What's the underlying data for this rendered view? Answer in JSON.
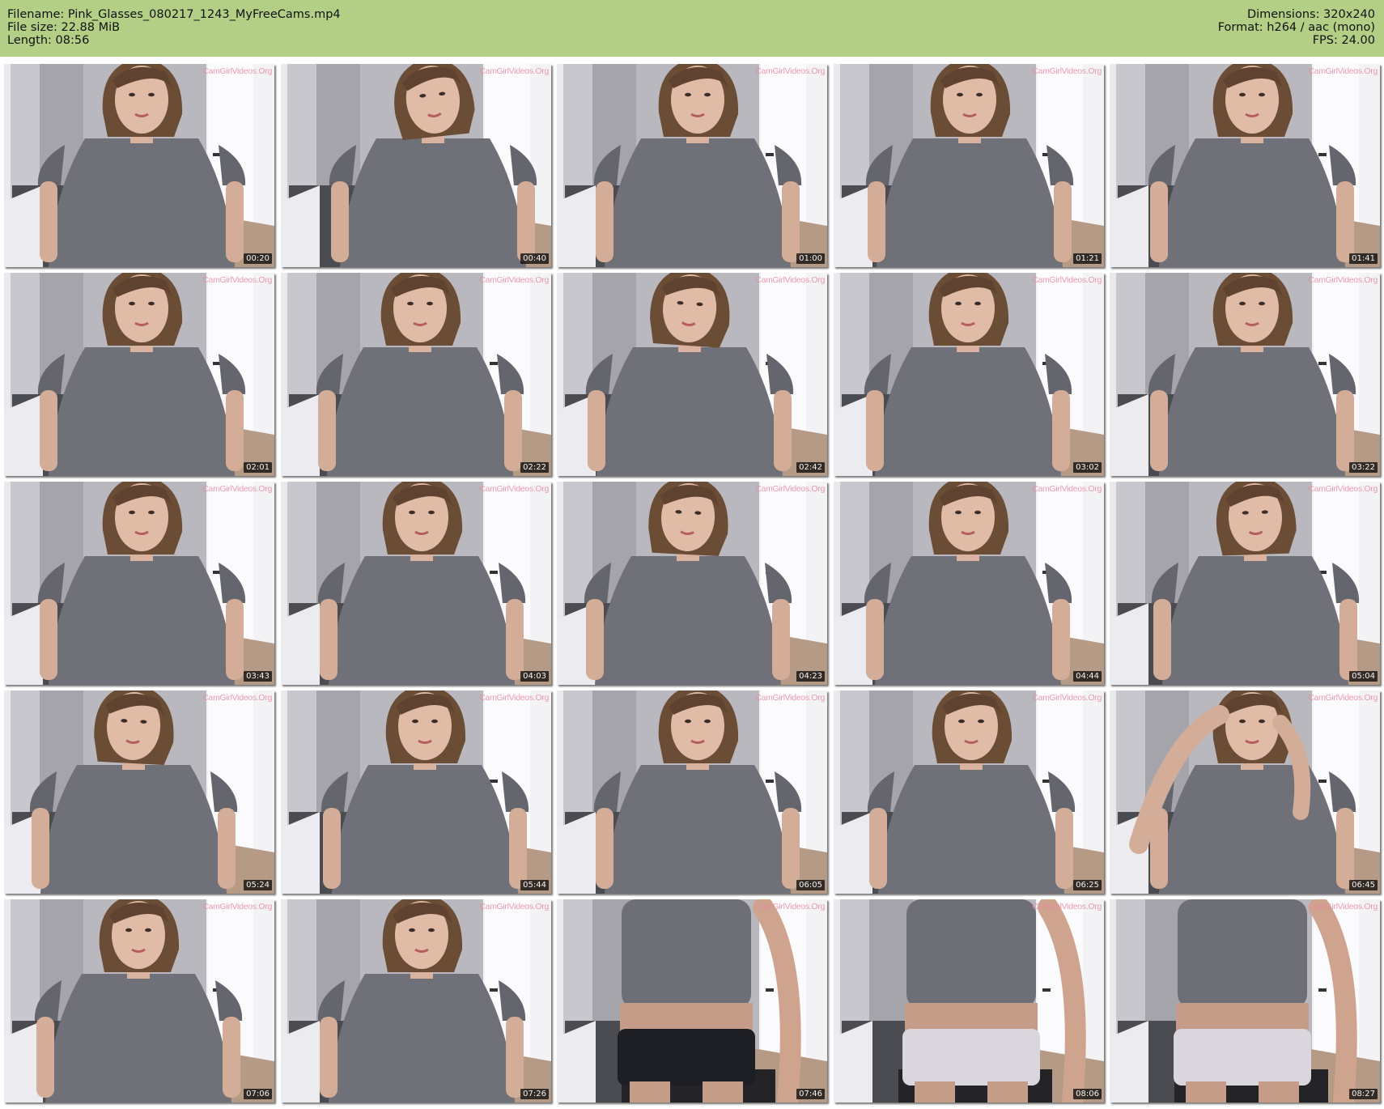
{
  "header": {
    "filename": "Filename: Pink_Glasses_080217_1243_MyFreeCams.mp4",
    "filesize": "File size: 22.88 MiB",
    "length": "Length: 08:56",
    "dimensions": "Dimensions: 320x240",
    "format": "Format: h264 / aac (mono)",
    "fps": "FPS: 24.00",
    "background_color": "#b3cf85"
  },
  "watermark": "CamGirlVideos.Org",
  "frames": [
    {
      "time": "00:20"
    },
    {
      "time": "00:40"
    },
    {
      "time": "01:00"
    },
    {
      "time": "01:21"
    },
    {
      "time": "01:41"
    },
    {
      "time": "02:01"
    },
    {
      "time": "02:22"
    },
    {
      "time": "02:42"
    },
    {
      "time": "03:02"
    },
    {
      "time": "03:22"
    },
    {
      "time": "03:43"
    },
    {
      "time": "04:03"
    },
    {
      "time": "04:23"
    },
    {
      "time": "04:44"
    },
    {
      "time": "05:04"
    },
    {
      "time": "05:24"
    },
    {
      "time": "05:44"
    },
    {
      "time": "06:05"
    },
    {
      "time": "06:25"
    },
    {
      "time": "06:45"
    },
    {
      "time": "07:06"
    },
    {
      "time": "07:26"
    },
    {
      "time": "07:46"
    },
    {
      "time": "08:06"
    },
    {
      "time": "08:27"
    }
  ]
}
